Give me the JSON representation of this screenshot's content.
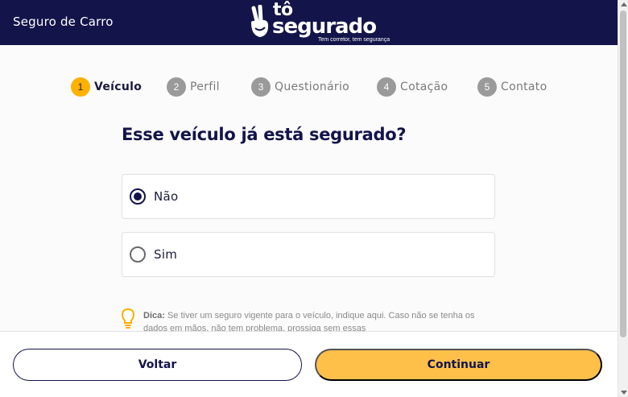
{
  "header": {
    "title": "Seguro de Carro",
    "logo_line1": "tô",
    "logo_line2": "segurado",
    "logo_tagline": "Tem corretor, tem segurança"
  },
  "steps": [
    {
      "num": "1",
      "label": "Veículo",
      "active": true
    },
    {
      "num": "2",
      "label": "Perfil",
      "active": false
    },
    {
      "num": "3",
      "label": "Questionário",
      "active": false
    },
    {
      "num": "4",
      "label": "Cotação",
      "active": false
    },
    {
      "num": "5",
      "label": "Contato",
      "active": false
    }
  ],
  "question": "Esse veículo já está segurado?",
  "options": [
    {
      "label": "Não",
      "selected": true
    },
    {
      "label": "Sim",
      "selected": false
    }
  ],
  "tip": {
    "title": "Dica:",
    "text": "Se tiver um seguro vigente para o veículo, indique aqui. Caso não se tenha os dados em mãos, não tem problema, prossiga sem essas"
  },
  "footer": {
    "back_label": "Voltar",
    "next_label": "Continuar"
  },
  "colors": {
    "navy": "#13144a",
    "accent": "#ffb100",
    "button_yellow": "#ffc04a"
  }
}
